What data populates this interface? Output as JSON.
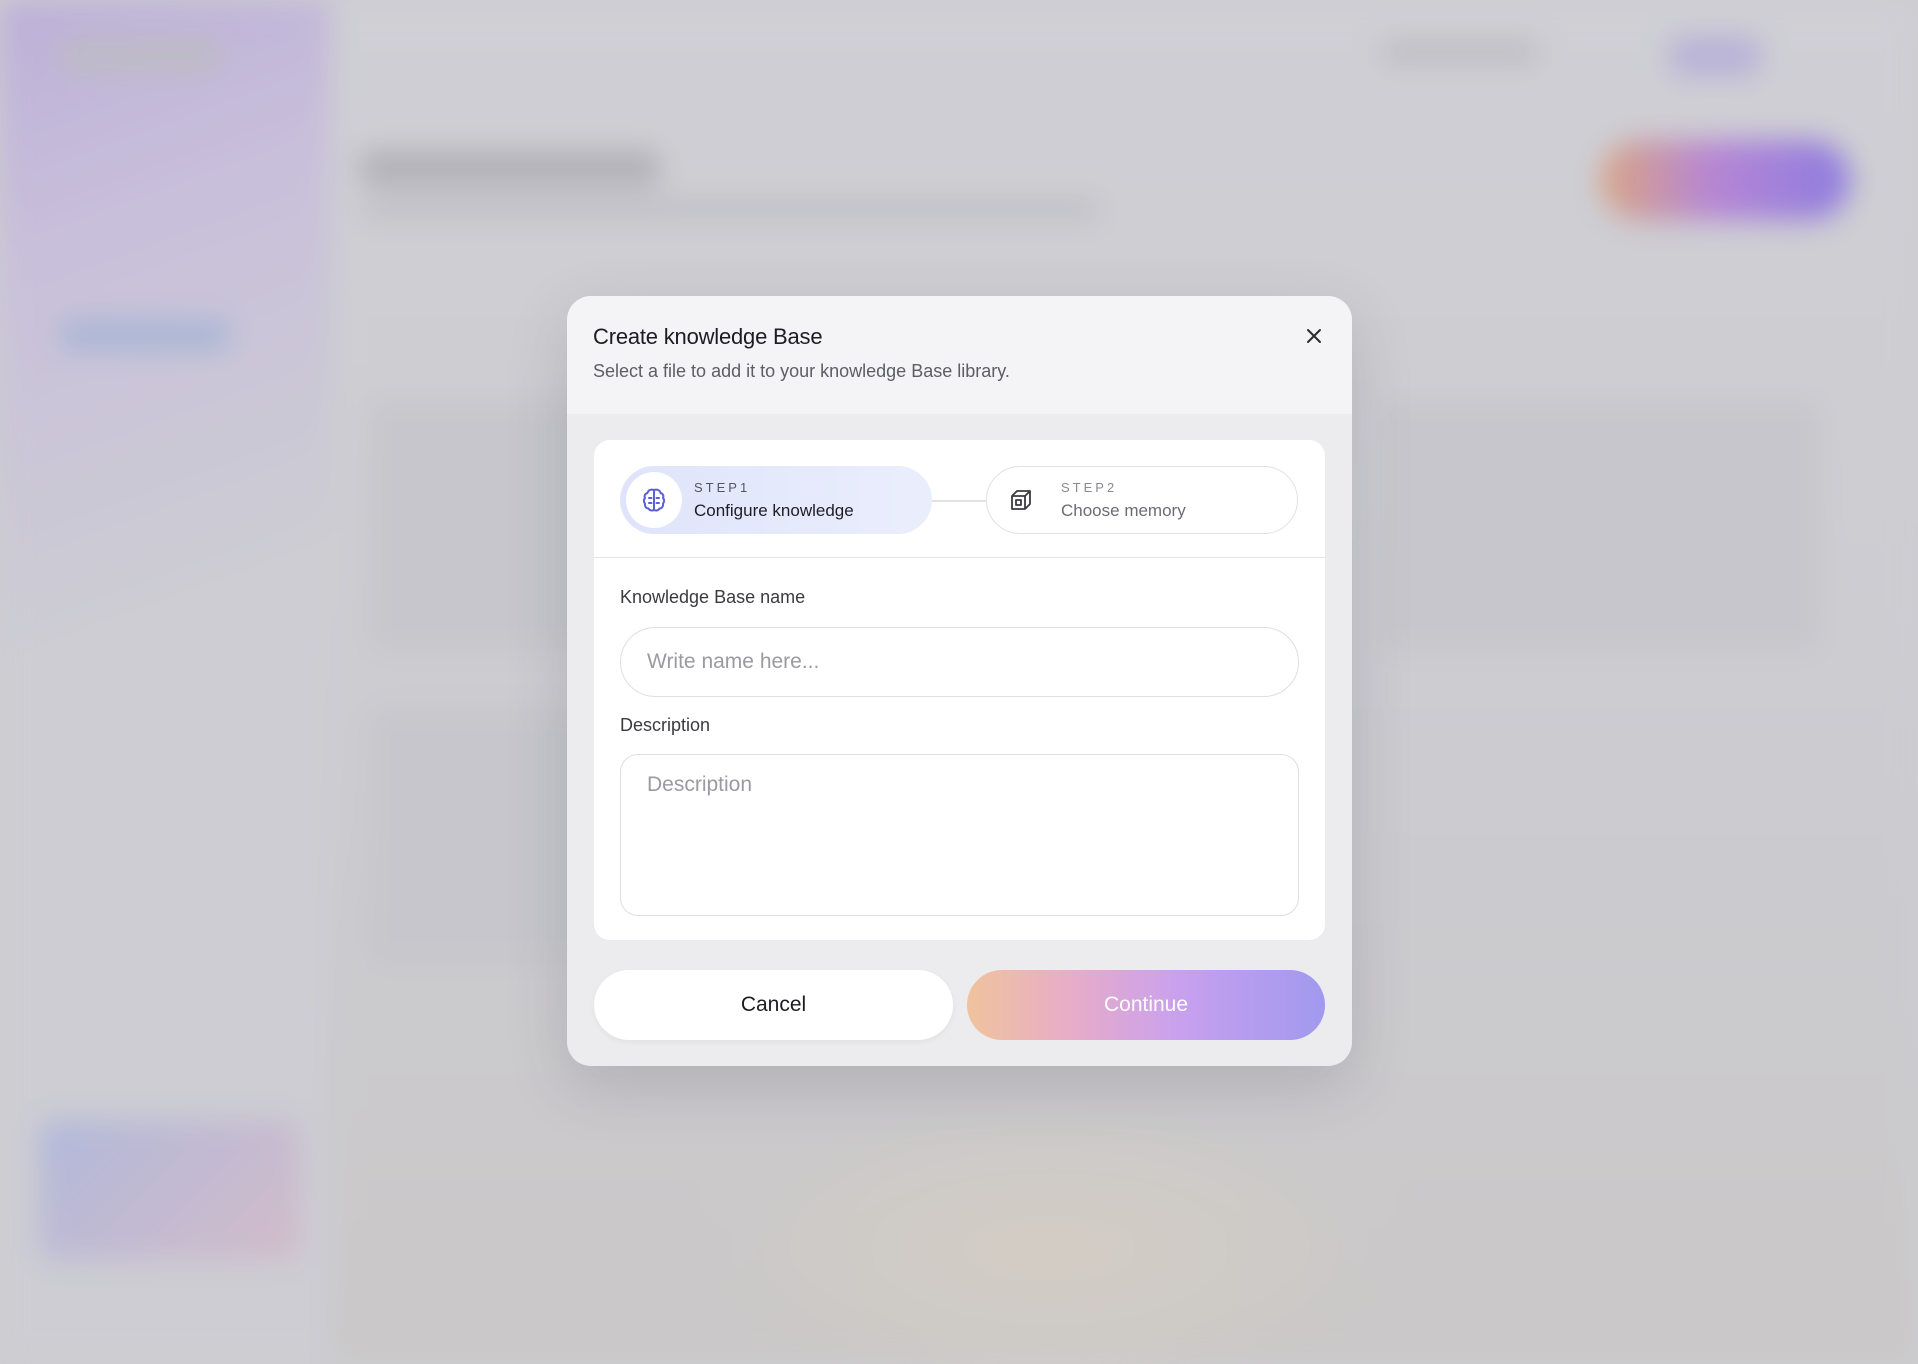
{
  "modal": {
    "title": "Create knowledge Base",
    "subtitle": "Select a file to add it to your knowledge Base library.",
    "close_icon": "close-icon"
  },
  "steps": [
    {
      "number": "STEP1",
      "label": "Configure knowledge",
      "icon": "brain-icon",
      "active": true
    },
    {
      "number": "STEP2",
      "label": "Choose memory",
      "icon": "cube-icon",
      "active": false
    }
  ],
  "form": {
    "name_label": "Knowledge Base name",
    "name_placeholder": "Write name here...",
    "name_value": "",
    "description_label": "Description",
    "description_placeholder": "Description",
    "description_value": ""
  },
  "actions": {
    "cancel_label": "Cancel",
    "continue_label": "Continue"
  },
  "colors": {
    "accent_gradient_start": "#f0bf96",
    "accent_gradient_end": "#9a92ee",
    "step_active_bg": "#dfe4fb",
    "step_icon_color": "#5b5fd6"
  }
}
